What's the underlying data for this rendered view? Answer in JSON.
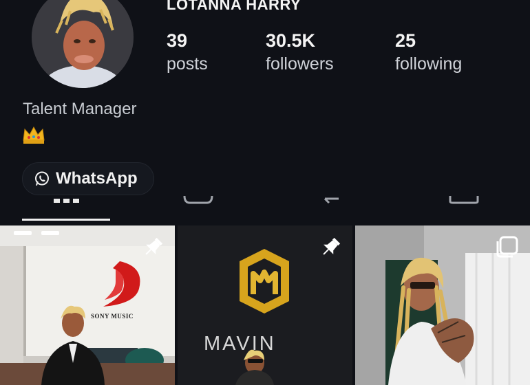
{
  "profile": {
    "username": "LOTANNA HARRY",
    "bio": "Talent Manager",
    "bio_emoji_icon": "crown-icon",
    "stats": [
      {
        "value": "39",
        "label": "posts"
      },
      {
        "value": "30.5K",
        "label": "followers"
      },
      {
        "value": "25",
        "label": "following"
      }
    ],
    "contact_button": {
      "label": "WhatsApp",
      "icon": "whatsapp-icon"
    }
  },
  "tabs": [
    {
      "name": "posts-grid-tab",
      "icon": "grid-icon",
      "active": true
    },
    {
      "name": "reels-tab",
      "icon": "reels-icon",
      "active": false
    },
    {
      "name": "reposts-tab",
      "icon": "repost-icon",
      "active": false
    },
    {
      "name": "tagged-tab",
      "icon": "tagged-icon",
      "active": false
    }
  ],
  "posts": [
    {
      "pinned": true,
      "sign_text": "SONY MUSIC"
    },
    {
      "pinned": true,
      "sign_text": "MAVIN"
    },
    {
      "pinned": false,
      "multi": true
    }
  ],
  "colors": {
    "background": "#0f1117",
    "text": "#f2f2f2",
    "muted": "#c8ccd2"
  }
}
